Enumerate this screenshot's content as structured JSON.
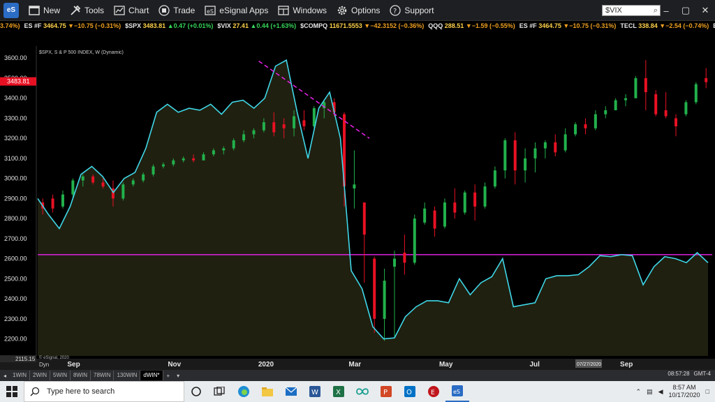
{
  "toolbar": {
    "logo_text": "eS",
    "new_label": "New",
    "tools_label": "Tools",
    "chart_label": "Chart",
    "trade_label": "Trade",
    "esignal_apps_label": "eSignal Apps",
    "windows_label": "Windows",
    "options_label": "Options",
    "support_label": "Support",
    "search_value": "$VIX"
  },
  "ticker": [
    {
      "sym": "",
      "price": "",
      "chg": "3.74%)",
      "dir": "dn"
    },
    {
      "sym": "ES #F",
      "price": "3464.75",
      "chg": "▼−10.75 (−0.31%)",
      "dir": "dn"
    },
    {
      "sym": "$SPX",
      "price": "3483.81",
      "chg": "▲0.47 (+0.01%)",
      "dir": "up"
    },
    {
      "sym": "$VIX",
      "price": "27.41",
      "chg": "▲0.44 (+1.63%)",
      "dir": "up"
    },
    {
      "sym": "$COMPQ",
      "price": "11671.5553",
      "chg": "▼−42.3152 (−0.36%)",
      "dir": "dn"
    },
    {
      "sym": "QQQ",
      "price": "288.51",
      "chg": "▼−1.59 (−0.55%)",
      "dir": "dn"
    },
    {
      "sym": "ES #F",
      "price": "3464.75",
      "chg": "▼−10.75 (−0.31%)",
      "dir": "dn"
    },
    {
      "sym": "TECL",
      "price": "338.84",
      "chg": "▼−2.54 (−0.74%)",
      "dir": "dn"
    },
    {
      "sym": "ES #F",
      "price": "3464.75",
      "chg": "",
      "dir": "dn"
    }
  ],
  "chart": {
    "title": "$SPX, S & P 500 INDEX, W (Dynamic)",
    "watermark": "© eSignal, 2020",
    "last_price_label": "3483.81",
    "bottom_value_label": "2115.15",
    "dyn_label": "Dyn",
    "crosshair_date": "07/27/2020",
    "colors": {
      "up": "#22b14c",
      "down": "#e81123",
      "line": "#3fd7e8",
      "support": "#e020e0",
      "trend": "#e020e0",
      "price_bg": "#e81123"
    }
  },
  "chart_data": {
    "type": "line",
    "title": "$SPX, S & P 500 INDEX, W (Dynamic)",
    "ylim": [
      2115,
      3660
    ],
    "yticks": [
      2200,
      2300,
      2400,
      2500,
      2600,
      2700,
      2800,
      2900,
      3000,
      3100,
      3200,
      3300,
      3400,
      3500,
      3600
    ],
    "xticks": [
      {
        "label": "Sep",
        "week": 5
      },
      {
        "label": "Nov",
        "week": 15
      },
      {
        "label": "2020",
        "week": 24
      },
      {
        "label": "Mar",
        "week": 33
      },
      {
        "label": "May",
        "week": 42
      },
      {
        "label": "Jul",
        "week": 51
      },
      {
        "label": "Sep",
        "week": 60
      }
    ],
    "week_count": 66,
    "candles": [
      {
        "o": 2850,
        "h": 2940,
        "l": 2820,
        "c": 2900
      },
      {
        "o": 2870,
        "h": 2920,
        "l": 2840,
        "c": 2880
      },
      {
        "o": 2880,
        "h": 2900,
        "l": 2820,
        "c": 2850
      },
      {
        "o": 2900,
        "h": 2920,
        "l": 2830,
        "c": 2850
      },
      {
        "o": 2860,
        "h": 2940,
        "l": 2850,
        "c": 2920
      },
      {
        "o": 2920,
        "h": 3000,
        "l": 2900,
        "c": 2990
      },
      {
        "o": 2990,
        "h": 3020,
        "l": 2960,
        "c": 3010
      },
      {
        "o": 3010,
        "h": 3020,
        "l": 2970,
        "c": 2980
      },
      {
        "o": 2980,
        "h": 3000,
        "l": 2950,
        "c": 2960
      },
      {
        "o": 2950,
        "h": 2990,
        "l": 2860,
        "c": 2900
      },
      {
        "o": 2900,
        "h": 2980,
        "l": 2890,
        "c": 2970
      },
      {
        "o": 2970,
        "h": 3000,
        "l": 2960,
        "c": 2990
      },
      {
        "o": 2990,
        "h": 3030,
        "l": 2980,
        "c": 3020
      },
      {
        "o": 3020,
        "h": 3070,
        "l": 3010,
        "c": 3060
      },
      {
        "o": 3060,
        "h": 3080,
        "l": 3050,
        "c": 3070
      },
      {
        "o": 3070,
        "h": 3100,
        "l": 3060,
        "c": 3090
      },
      {
        "o": 3090,
        "h": 3110,
        "l": 3080,
        "c": 3100
      },
      {
        "o": 3100,
        "h": 3120,
        "l": 3080,
        "c": 3090
      },
      {
        "o": 3090,
        "h": 3130,
        "l": 3090,
        "c": 3120
      },
      {
        "o": 3120,
        "h": 3150,
        "l": 3110,
        "c": 3140
      },
      {
        "o": 3140,
        "h": 3160,
        "l": 3120,
        "c": 3150
      },
      {
        "o": 3150,
        "h": 3200,
        "l": 3140,
        "c": 3190
      },
      {
        "o": 3190,
        "h": 3240,
        "l": 3180,
        "c": 3220
      },
      {
        "o": 3220,
        "h": 3250,
        "l": 3200,
        "c": 3240
      },
      {
        "o": 3240,
        "h": 3300,
        "l": 3230,
        "c": 3280
      },
      {
        "o": 3280,
        "h": 3330,
        "l": 3210,
        "c": 3230
      },
      {
        "o": 3270,
        "h": 3300,
        "l": 3200,
        "c": 3250
      },
      {
        "o": 3250,
        "h": 3340,
        "l": 3210,
        "c": 3310
      },
      {
        "o": 3290,
        "h": 3340,
        "l": 3240,
        "c": 3260
      },
      {
        "o": 3260,
        "h": 3360,
        "l": 3250,
        "c": 3350
      },
      {
        "o": 3350,
        "h": 3390,
        "l": 3300,
        "c": 3380
      },
      {
        "o": 3380,
        "h": 3400,
        "l": 3310,
        "c": 3330
      },
      {
        "o": 3320,
        "h": 3330,
        "l": 2860,
        "c": 2960
      },
      {
        "o": 2950,
        "h": 3140,
        "l": 2850,
        "c": 2970
      },
      {
        "o": 2880,
        "h": 2880,
        "l": 2480,
        "c": 2720
      },
      {
        "o": 2600,
        "h": 2610,
        "l": 2230,
        "c": 2300
      },
      {
        "o": 2300,
        "h": 2550,
        "l": 2190,
        "c": 2490
      },
      {
        "o": 2560,
        "h": 2640,
        "l": 2210,
        "c": 2600
      },
      {
        "o": 2630,
        "h": 2720,
        "l": 2520,
        "c": 2580
      },
      {
        "o": 2580,
        "h": 2820,
        "l": 2570,
        "c": 2800
      },
      {
        "o": 2780,
        "h": 2880,
        "l": 2770,
        "c": 2850
      },
      {
        "o": 2840,
        "h": 2860,
        "l": 2710,
        "c": 2750
      },
      {
        "o": 2760,
        "h": 2900,
        "l": 2750,
        "c": 2880
      },
      {
        "o": 2880,
        "h": 2950,
        "l": 2800,
        "c": 2830
      },
      {
        "o": 2830,
        "h": 2940,
        "l": 2820,
        "c": 2930
      },
      {
        "o": 2930,
        "h": 2970,
        "l": 2790,
        "c": 2860
      },
      {
        "o": 2860,
        "h": 2980,
        "l": 2850,
        "c": 2960
      },
      {
        "o": 2960,
        "h": 3060,
        "l": 2950,
        "c": 3040
      },
      {
        "o": 3040,
        "h": 3200,
        "l": 3000,
        "c": 3190
      },
      {
        "o": 3190,
        "h": 3230,
        "l": 2970,
        "c": 3040
      },
      {
        "o": 3040,
        "h": 3150,
        "l": 2980,
        "c": 3100
      },
      {
        "o": 3100,
        "h": 3180,
        "l": 3030,
        "c": 3150
      },
      {
        "o": 3150,
        "h": 3190,
        "l": 3100,
        "c": 3180
      },
      {
        "o": 3180,
        "h": 3220,
        "l": 3110,
        "c": 3130
      },
      {
        "o": 3140,
        "h": 3250,
        "l": 3130,
        "c": 3220
      },
      {
        "o": 3220,
        "h": 3280,
        "l": 3210,
        "c": 3270
      },
      {
        "o": 3270,
        "h": 3300,
        "l": 3220,
        "c": 3250
      },
      {
        "o": 3250,
        "h": 3340,
        "l": 3240,
        "c": 3320
      },
      {
        "o": 3320,
        "h": 3360,
        "l": 3300,
        "c": 3340
      },
      {
        "o": 3340,
        "h": 3400,
        "l": 3340,
        "c": 3390
      },
      {
        "o": 3390,
        "h": 3420,
        "l": 3360,
        "c": 3400
      },
      {
        "o": 3400,
        "h": 3510,
        "l": 3400,
        "c": 3500
      },
      {
        "o": 3500,
        "h": 3590,
        "l": 3340,
        "c": 3430
      },
      {
        "o": 3420,
        "h": 3440,
        "l": 3310,
        "c": 3320
      },
      {
        "o": 3340,
        "h": 3430,
        "l": 3300,
        "c": 3310
      },
      {
        "o": 3300,
        "h": 3320,
        "l": 3210,
        "c": 3260
      },
      {
        "o": 3320,
        "h": 3390,
        "l": 3310,
        "c": 3380
      },
      {
        "o": 3380,
        "h": 3480,
        "l": 3370,
        "c": 3470
      },
      {
        "o": 3500,
        "h": 3550,
        "l": 3450,
        "c": 3480
      }
    ],
    "line_series": [
      2900,
      2820,
      2750,
      2860,
      3020,
      3060,
      3010,
      2930,
      3000,
      3030,
      3150,
      3330,
      3370,
      3330,
      3350,
      3340,
      3370,
      3320,
      3380,
      3390,
      3350,
      3400,
      3560,
      3590,
      3330,
      3100,
      3350,
      3430,
      3200,
      2540,
      2450,
      2260,
      2200,
      2205,
      2310,
      2360,
      2390,
      2390,
      2380,
      2500,
      2420,
      2480,
      2510,
      2600,
      2360,
      2370,
      2380,
      2500,
      2515,
      2515,
      2520,
      2560,
      2615,
      2610,
      2620,
      2615,
      2470,
      2560,
      2610,
      2600,
      2580,
      2630,
      2580
    ],
    "support_level": 2620,
    "trendline": [
      {
        "week": 23.5,
        "value": 3585
      },
      {
        "week": 34.5,
        "value": 3200
      }
    ]
  },
  "tabs": {
    "items": [
      "1WIN",
      "2WIN",
      "5WIN",
      "8WIN",
      "78WIN",
      "130WIN",
      "dWIN*"
    ],
    "add_label": "+",
    "status_time": "08:57:28",
    "status_tz": "GMT-4"
  },
  "taskbar": {
    "search_placeholder": "Type here to search",
    "time": "8:57 AM",
    "date": "10/17/2020"
  }
}
